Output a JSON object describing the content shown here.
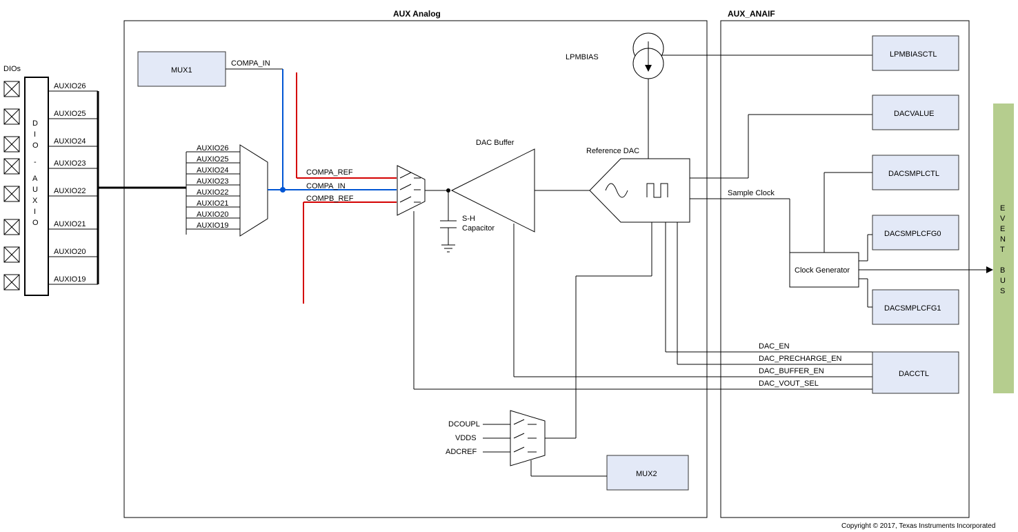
{
  "titles": {
    "aux_analog": "AUX Analog",
    "aux_anaif": "AUX_ANAIF",
    "dios": "DIOs"
  },
  "dio_label": "DIO - AUXIO",
  "auxio_pins": [
    "AUXIO26",
    "AUXIO25",
    "AUXIO24",
    "AUXIO23",
    "AUXIO22",
    "AUXIO21",
    "AUXIO20",
    "AUXIO19"
  ],
  "mux_inputs": [
    "AUXIO26",
    "AUXIO25",
    "AUXIO24",
    "AUXIO23",
    "AUXIO22",
    "AUXIO21",
    "AUXIO20",
    "AUXIO19"
  ],
  "blocks": {
    "mux1": "MUX1",
    "mux2": "MUX2",
    "clock_gen": "Clock Generator",
    "lpmbiasctl": "LPMBIASCTL",
    "dacvalue": "DACVALUE",
    "dacsmplctl": "DACSMPLCTL",
    "dacsmplcfg0": "DACSMPLCFG0",
    "dacsmplcfg1": "DACSMPLCFG1",
    "dacctl": "DACCTL"
  },
  "labels": {
    "compa_in": "COMPA_IN",
    "compa_ref": "COMPA_REF",
    "compb_ref": "COMPB_REF",
    "dac_buffer": "DAC Buffer",
    "reference_dac": "Reference DAC",
    "sh_cap": "S-H\nCapacitor",
    "lpmbias": "LPMBIAS",
    "sample_clock": "Sample Clock",
    "dac_en": "DAC_EN",
    "dac_precharge_en": "DAC_PRECHARGE_EN",
    "dac_buffer_en": "DAC_BUFFER_EN",
    "dac_vout_sel": "DAC_VOUT_SEL",
    "dcoupl": "DCOUPL",
    "vdds": "VDDS",
    "adcref": "ADCREF",
    "eventbus": "EVENT BUS"
  },
  "copyright": "Copyright © 2017, Texas Instruments Incorporated"
}
